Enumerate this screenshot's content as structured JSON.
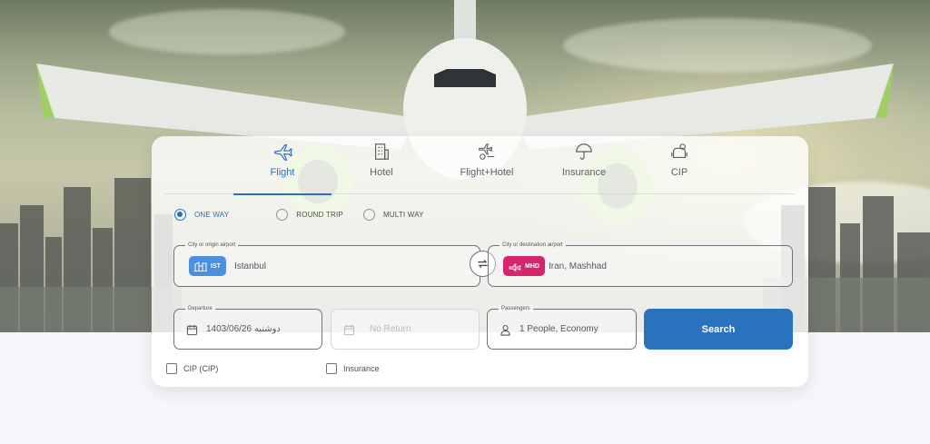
{
  "tabs": [
    {
      "label": "Flight",
      "icon": "airplane-icon",
      "active": true
    },
    {
      "label": "Hotel",
      "icon": "hotel-icon",
      "active": false
    },
    {
      "label": "Flight+Hotel",
      "icon": "flight-hotel-icon",
      "active": false
    },
    {
      "label": "Insurance",
      "icon": "umbrella-icon",
      "active": false
    },
    {
      "label": "CIP",
      "icon": "cip-lounge-icon",
      "active": false
    }
  ],
  "trip_types": [
    {
      "label": "ONE WAY",
      "selected": true
    },
    {
      "label": "ROUND TRIP",
      "selected": false
    },
    {
      "label": "MULTI WAY",
      "selected": false
    }
  ],
  "origin": {
    "legend": "City or origin airport",
    "code": "IST",
    "value": "Istanbul",
    "badge_color": "#4a8fe0"
  },
  "destination": {
    "legend": "City or destination airport",
    "code": "MHD",
    "value": "Iran, Mashhad",
    "badge_color": "#d6246e"
  },
  "departure": {
    "legend": "Departure",
    "value": "1403/06/26 دوشنبه"
  },
  "return": {
    "value": "No Return"
  },
  "passengers": {
    "legend": "Passengers",
    "value": "1 People, Economy"
  },
  "search_label": "Search",
  "options": [
    {
      "label": "CIP (CIP)"
    },
    {
      "label": "Insurance"
    }
  ],
  "colors": {
    "accent": "#2a72bd",
    "active_tab": "#2c6fb5"
  }
}
